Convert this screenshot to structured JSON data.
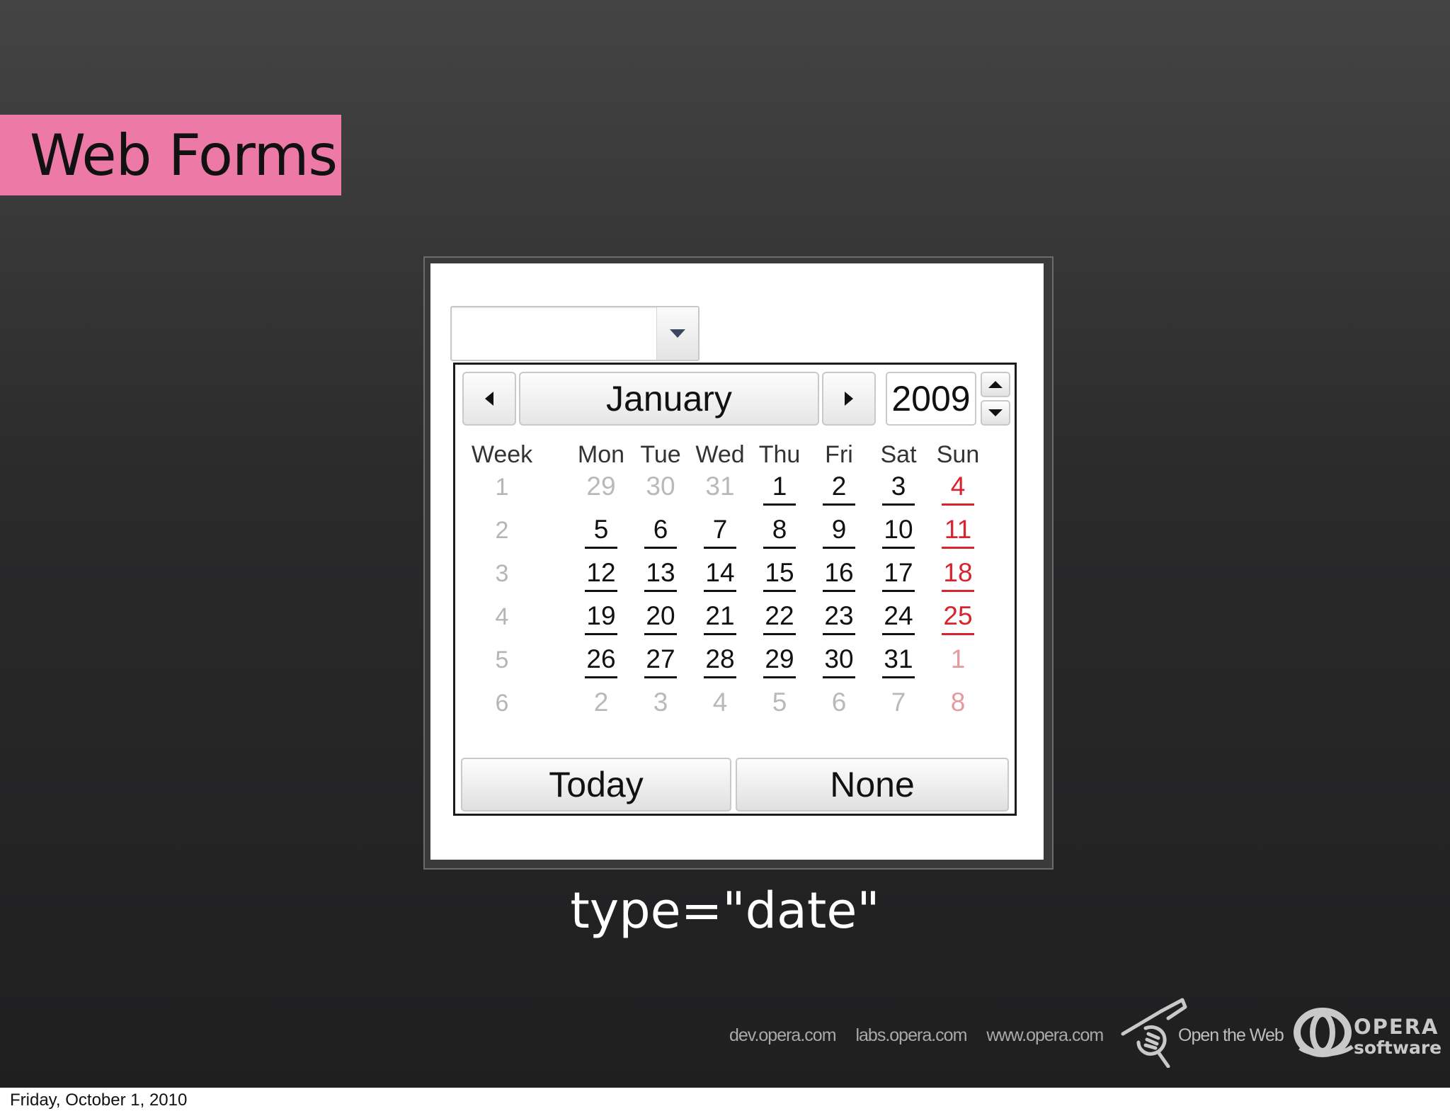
{
  "slide": {
    "title": "Web Forms",
    "caption": "type=\"date\""
  },
  "date_input": {
    "value": "",
    "dropdown_icon": "triangle-down-icon"
  },
  "calendar": {
    "month": "January",
    "year": "2009",
    "icons": {
      "prev": "triangle-left-icon",
      "next": "triangle-right-icon",
      "year_up": "triangle-up-icon",
      "year_down": "triangle-down-icon"
    },
    "week_header": "Week",
    "day_headers": [
      "Mon",
      "Tue",
      "Wed",
      "Thu",
      "Fri",
      "Sat",
      "Sun"
    ],
    "weeks": [
      {
        "week": "1",
        "days": [
          {
            "d": "29",
            "cur": false
          },
          {
            "d": "30",
            "cur": false
          },
          {
            "d": "31",
            "cur": false
          },
          {
            "d": "1",
            "cur": true
          },
          {
            "d": "2",
            "cur": true
          },
          {
            "d": "3",
            "cur": true
          },
          {
            "d": "4",
            "cur": true
          }
        ]
      },
      {
        "week": "2",
        "days": [
          {
            "d": "5",
            "cur": true
          },
          {
            "d": "6",
            "cur": true
          },
          {
            "d": "7",
            "cur": true
          },
          {
            "d": "8",
            "cur": true
          },
          {
            "d": "9",
            "cur": true
          },
          {
            "d": "10",
            "cur": true
          },
          {
            "d": "11",
            "cur": true
          }
        ]
      },
      {
        "week": "3",
        "days": [
          {
            "d": "12",
            "cur": true
          },
          {
            "d": "13",
            "cur": true
          },
          {
            "d": "14",
            "cur": true
          },
          {
            "d": "15",
            "cur": true
          },
          {
            "d": "16",
            "cur": true
          },
          {
            "d": "17",
            "cur": true
          },
          {
            "d": "18",
            "cur": true
          }
        ]
      },
      {
        "week": "4",
        "days": [
          {
            "d": "19",
            "cur": true
          },
          {
            "d": "20",
            "cur": true
          },
          {
            "d": "21",
            "cur": true
          },
          {
            "d": "22",
            "cur": true
          },
          {
            "d": "23",
            "cur": true
          },
          {
            "d": "24",
            "cur": true
          },
          {
            "d": "25",
            "cur": true
          }
        ]
      },
      {
        "week": "5",
        "days": [
          {
            "d": "26",
            "cur": true
          },
          {
            "d": "27",
            "cur": true
          },
          {
            "d": "28",
            "cur": true
          },
          {
            "d": "29",
            "cur": true
          },
          {
            "d": "30",
            "cur": true
          },
          {
            "d": "31",
            "cur": true
          },
          {
            "d": "1",
            "cur": false
          }
        ]
      },
      {
        "week": "6",
        "days": [
          {
            "d": "2",
            "cur": false
          },
          {
            "d": "3",
            "cur": false
          },
          {
            "d": "4",
            "cur": false
          },
          {
            "d": "5",
            "cur": false
          },
          {
            "d": "6",
            "cur": false
          },
          {
            "d": "7",
            "cur": false
          },
          {
            "d": "8",
            "cur": false
          }
        ]
      }
    ],
    "today_label": "Today",
    "none_label": "None"
  },
  "footer": {
    "links": [
      "dev.opera.com",
      "labs.opera.com",
      "www.opera.com"
    ],
    "tagline": "Open the Web",
    "brand_name": "OPERA",
    "brand_sub": "software",
    "tagline_icon": "hammer-fist-icon",
    "brand_icon": "opera-logo-icon"
  },
  "date_stamp": "Friday, October 1, 2010",
  "colors": {
    "title_bg": "#ed7aa6",
    "sunday": "#d9232e",
    "muted_day": "#b9b9b9"
  }
}
